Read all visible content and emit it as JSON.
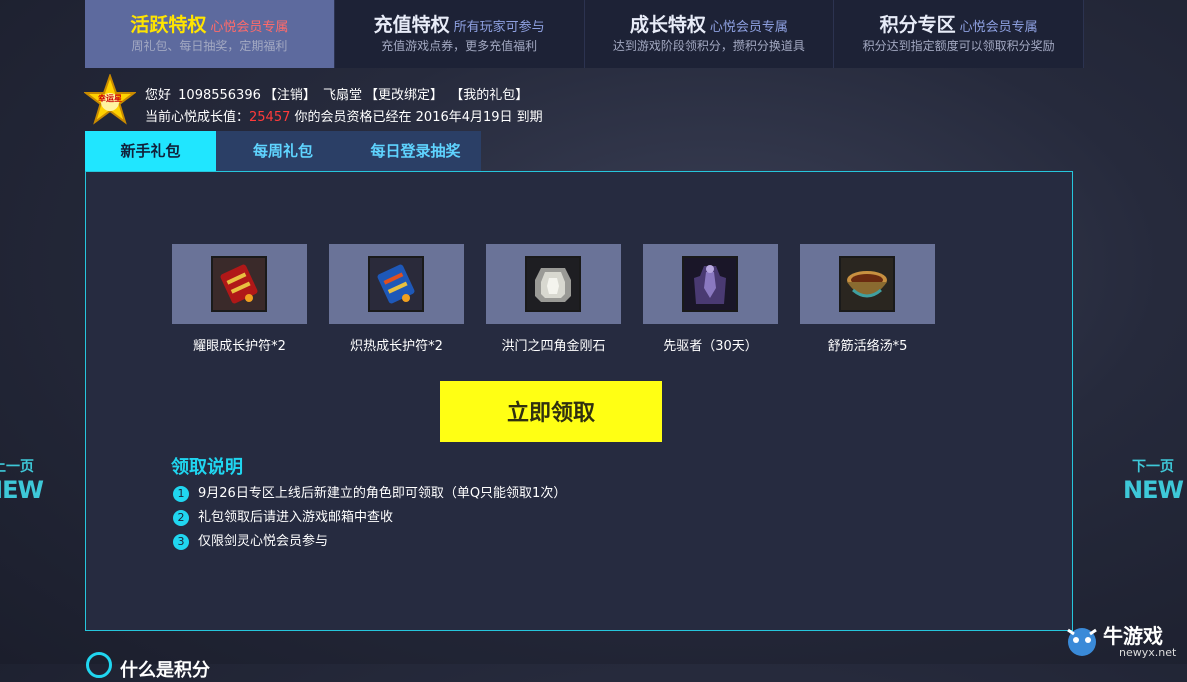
{
  "top_tabs": [
    {
      "title": "活跃特权",
      "tag": "心悦会员专属",
      "desc": "周礼包、每日抽奖，定期福利"
    },
    {
      "title": "充值特权",
      "tag": "所有玩家可参与",
      "desc": "充值游戏点券，更多充值福利"
    },
    {
      "title": "成长特权",
      "tag": "心悦会员专属",
      "desc": "达到游戏阶段领积分，攒积分换道具"
    },
    {
      "title": "积分专区",
      "tag": "心悦会员专属",
      "desc": "积分达到指定额度可以领取积分奖励"
    }
  ],
  "user": {
    "badge_text": "幸运星",
    "greeting": "您好",
    "qq": "1098556396",
    "logout": "【注销】",
    "server": "飞扇堂",
    "change_bind": "【更改绑定】",
    "my_gifts": "【我的礼包】",
    "growth_label": "当前心悦成长值：",
    "growth_value": "25457",
    "membership_text": "你的会员资格已经在 2016年4月19日 到期"
  },
  "sub_tabs": [
    "新手礼包",
    "每周礼包",
    "每日登录抽奖"
  ],
  "items": [
    {
      "name": "耀眼成长护符*2",
      "icon": "red-talisman-icon"
    },
    {
      "name": "炽热成长护符*2",
      "icon": "blue-talisman-icon"
    },
    {
      "name": "洪门之四角金刚石",
      "icon": "diamond-icon"
    },
    {
      "name": "先驱者（30天）",
      "icon": "armor-costume-icon"
    },
    {
      "name": "舒筋活络汤*5",
      "icon": "soup-bowl-icon"
    }
  ],
  "claim_button": "立即领取",
  "desc_title": "领取说明",
  "rules": [
    {
      "num": "1",
      "text": "9月26日专区上线后新建立的角色即可领取（单Q只能领取1次）"
    },
    {
      "num": "2",
      "text": "礼包领取后请进入游戏邮箱中查收"
    },
    {
      "num": "3",
      "text": "仅限剑灵心悦会员参与"
    }
  ],
  "prev_page": {
    "cn": "上一页",
    "en": "NEW"
  },
  "next_page": {
    "cn": "下一页",
    "en": "NEW"
  },
  "bottom_heading": "什么是积分",
  "watermark": {
    "brand": "牛游戏",
    "url": "newyx.net"
  },
  "colors": {
    "accent_cyan": "#20d6f0",
    "active_tab": "#5d6a9e",
    "claim_yellow": "#ffff14",
    "highlight_red": "#ff3a3a"
  }
}
